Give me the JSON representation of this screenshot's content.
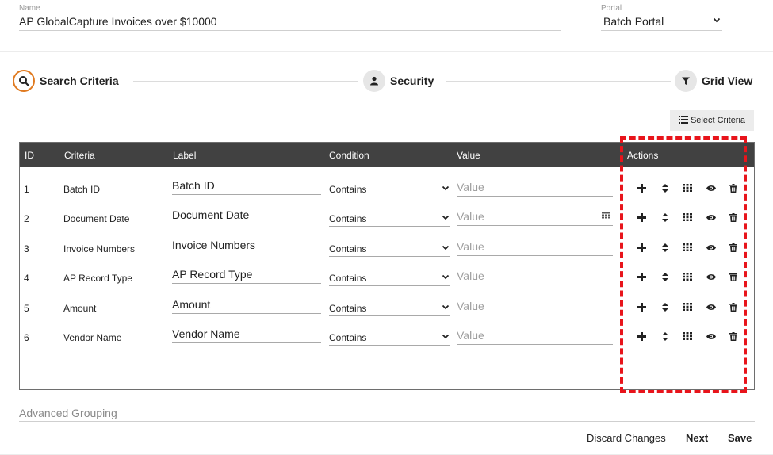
{
  "header": {
    "name_label": "Name",
    "name_value": "AP GlobalCapture Invoices over $10000",
    "portal_label": "Portal",
    "portal_value": "Batch Portal"
  },
  "steps": [
    {
      "label": "Search Criteria",
      "icon": "search-icon",
      "active": true
    },
    {
      "label": "Security",
      "icon": "user-icon",
      "active": false
    },
    {
      "label": "Grid View",
      "icon": "filter-icon",
      "active": false
    }
  ],
  "toolbar": {
    "select_criteria_label": "Select Criteria",
    "select_criteria_icon": "list-icon"
  },
  "grid": {
    "columns": [
      "ID",
      "Criteria",
      "Label",
      "Condition",
      "Value",
      "Actions"
    ],
    "rows": [
      {
        "id": "1",
        "criteria": "Batch ID",
        "label": "Batch ID",
        "condition": "Contains",
        "value_placeholder": "Value",
        "has_calendar": false
      },
      {
        "id": "2",
        "criteria": "Document Date",
        "label": "Document Date",
        "condition": "Contains",
        "value_placeholder": "Value",
        "has_calendar": true
      },
      {
        "id": "3",
        "criteria": "Invoice Numbers",
        "label": "Invoice Numbers",
        "condition": "Contains",
        "value_placeholder": "Value",
        "has_calendar": false
      },
      {
        "id": "4",
        "criteria": "AP Record Type",
        "label": "AP Record Type",
        "condition": "Contains",
        "value_placeholder": "Value",
        "has_calendar": false
      },
      {
        "id": "5",
        "criteria": "Amount",
        "label": "Amount",
        "condition": "Contains",
        "value_placeholder": "Value",
        "has_calendar": false
      },
      {
        "id": "6",
        "criteria": "Vendor Name",
        "label": "Vendor Name",
        "condition": "Contains",
        "value_placeholder": "Value",
        "has_calendar": false
      }
    ],
    "action_icons": [
      "plus-icon",
      "sort-icon",
      "grid-icon",
      "eye-icon",
      "trash-icon"
    ]
  },
  "footer": {
    "advanced_grouping": "Advanced Grouping",
    "discard_label": "Discard Changes",
    "next_label": "Next",
    "save_label": "Save"
  },
  "colors": {
    "accent": "#e07a20",
    "grid_header": "#414141",
    "highlight": "#e8141b"
  }
}
